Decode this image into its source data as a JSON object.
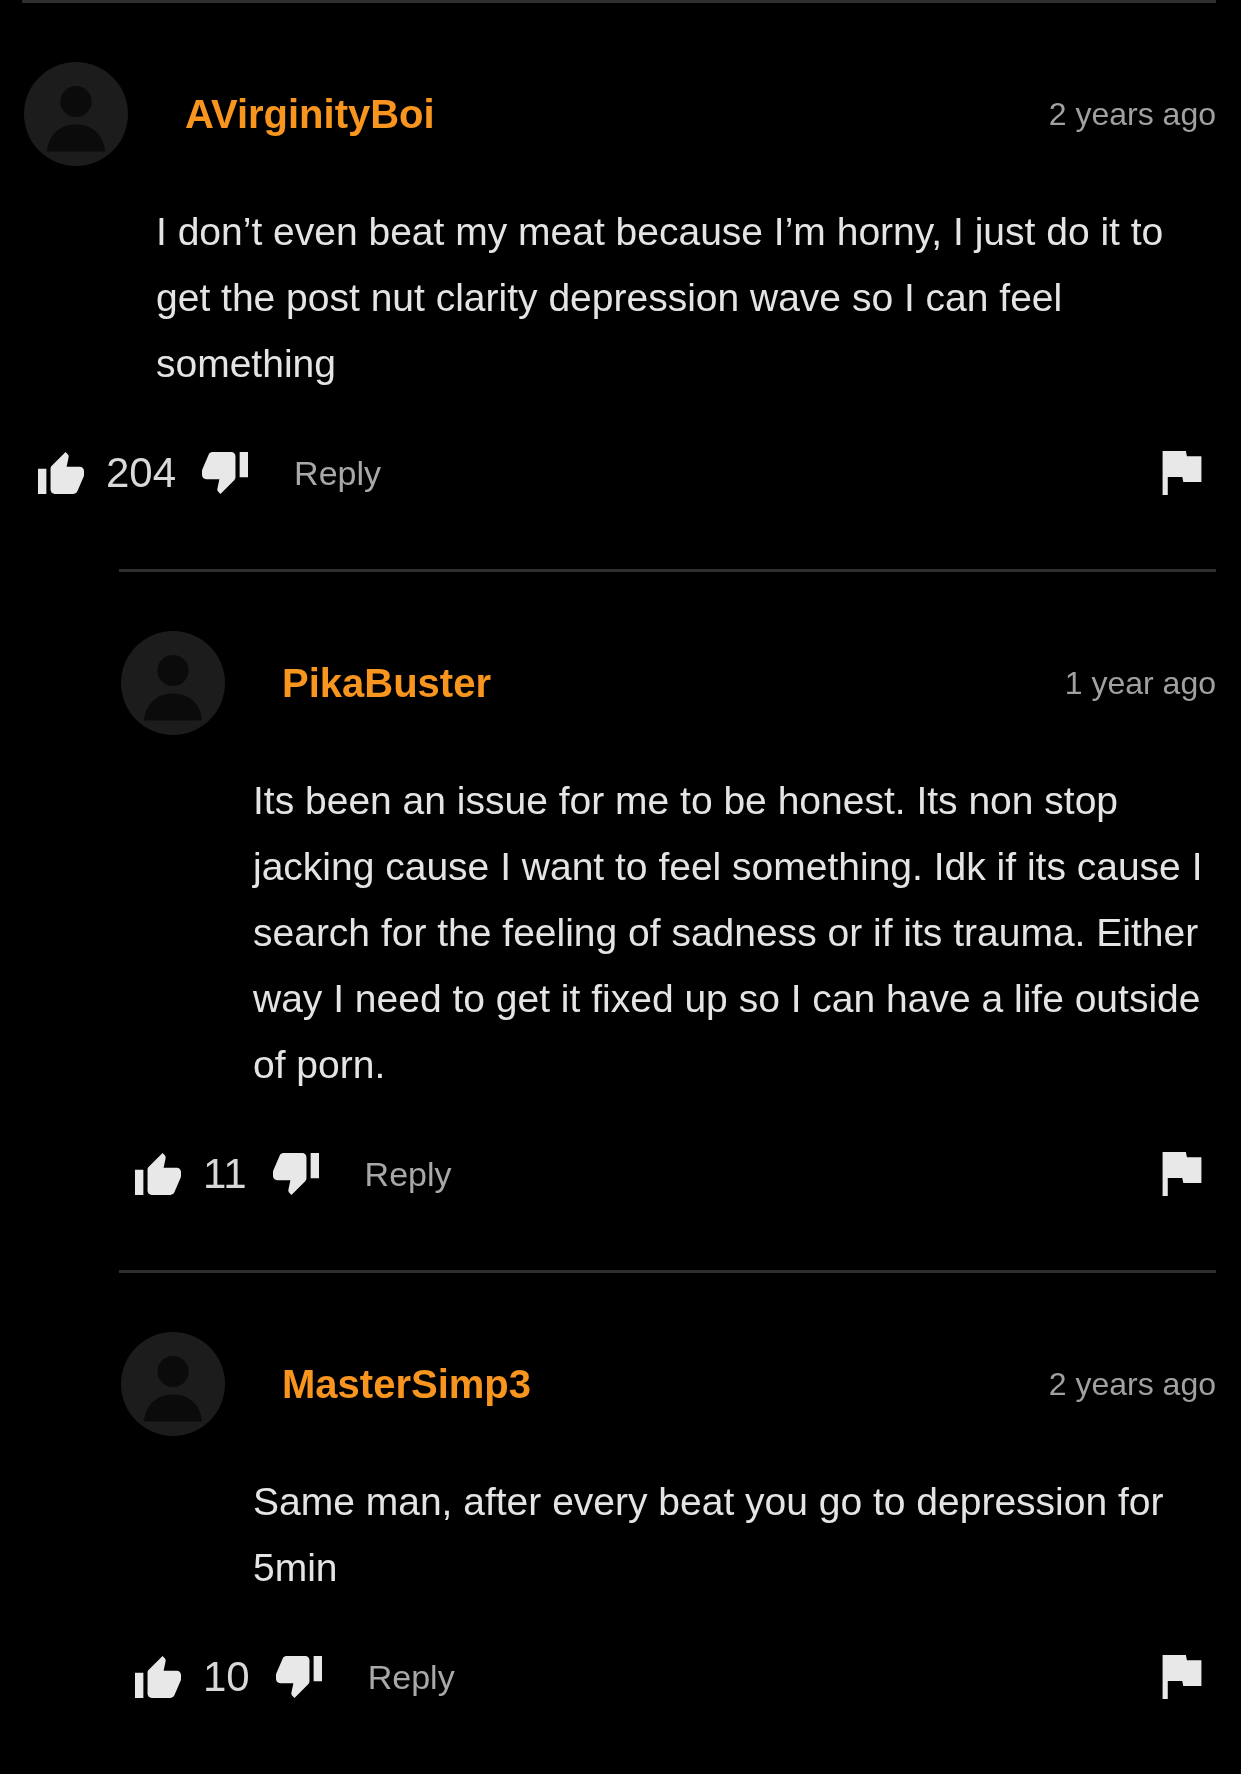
{
  "comments": [
    {
      "user": "AVirginityBoi",
      "time": "2 years ago",
      "text": "I don’t even beat my meat because I’m horny, I just do it to get the post nut clarity depression wave so I can feel something",
      "likes": "204",
      "action": "Reply",
      "replies": [
        {
          "user": "PikaBuster",
          "time": "1 year ago",
          "text": "Its been an issue for me to be honest. Its non stop jacking cause I want to feel something. Idk if its cause I search for the feeling of sadness or if its trauma. Either way I need to get it fixed up so I can have a life outside of porn.",
          "likes": "11",
          "action": "Reply"
        },
        {
          "user": "MasterSimp3",
          "time": "2 years ago",
          "text": "Same man, after every beat you go to depression for 5min",
          "likes": "10",
          "action": "Reply"
        }
      ]
    }
  ]
}
